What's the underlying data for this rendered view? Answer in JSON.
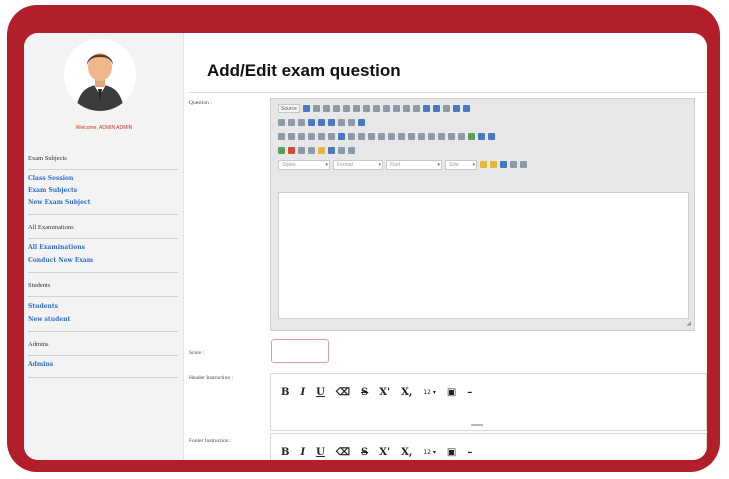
{
  "sidebar": {
    "welcome": "Welcome, ADMIN ADMIN",
    "sections": [
      {
        "heading": "Exam Subjects",
        "links": [
          "Class Session",
          "Exam Subjects",
          "New Exam Subject"
        ]
      },
      {
        "heading": "All Examinations",
        "links": [
          "All Examinations",
          "Conduct New Exam"
        ]
      },
      {
        "heading": "Students",
        "links": [
          "Students",
          "New student"
        ]
      },
      {
        "heading": "Admins",
        "links": [
          "Admins"
        ]
      }
    ]
  },
  "main": {
    "title": "Add/Edit exam question",
    "question_label": "Question :",
    "score_label": "Score :",
    "header_label": "Header Instruction :",
    "footer_label": "Footer Instruction :"
  },
  "editor": {
    "source_label": "Source",
    "styles_placeholder": "Styles",
    "format_placeholder": "Format",
    "font_placeholder": "Font",
    "size_placeholder": "Size"
  },
  "mini_toolbar": {
    "bold": "B",
    "italic": "I",
    "underline": "U",
    "strike": "S",
    "superscript": "X'",
    "subscript": "X,",
    "font_size": "12 ▾",
    "hr": "–"
  },
  "colors": {
    "frame": "#b21f2a",
    "link": "#2f6fd1",
    "welcome": "#c0392b",
    "score_border": "#e49aa5"
  }
}
